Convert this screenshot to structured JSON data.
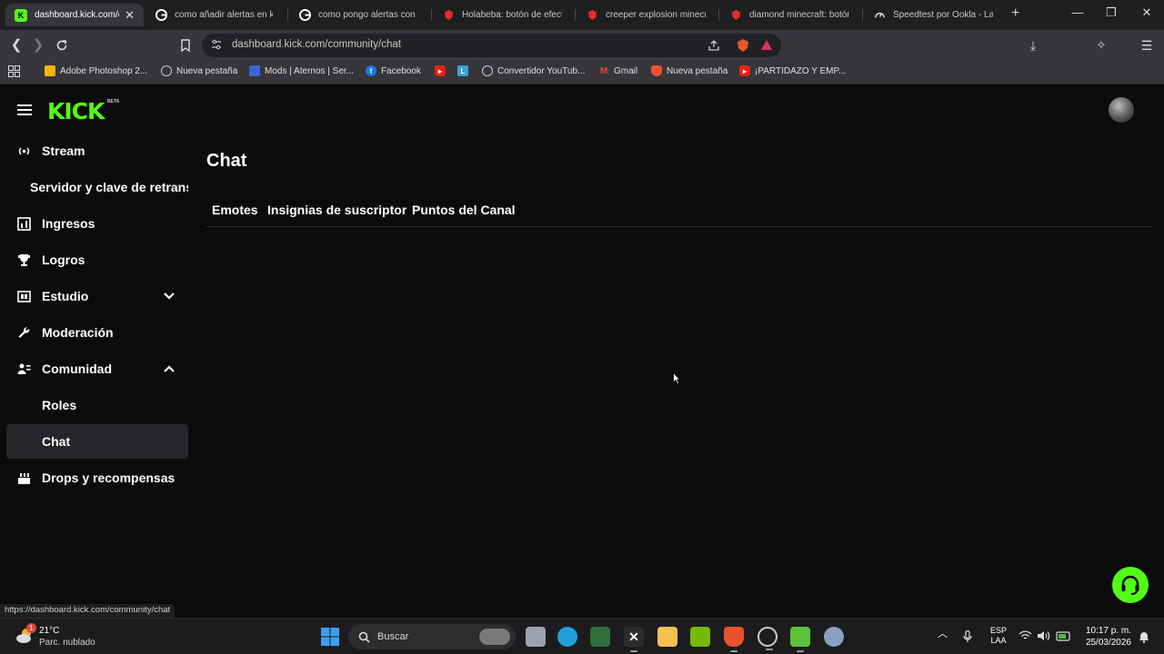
{
  "browser": {
    "tabs": [
      {
        "title": "dashboard.kick.com/c",
        "favicon": "kick-icon",
        "active": true
      },
      {
        "title": "como añadir alertas en kick",
        "favicon": "google-icon"
      },
      {
        "title": "como pongo alertas con p",
        "favicon": "google-icon"
      },
      {
        "title": "Holabeba: botón de efecto",
        "favicon": "brave-icon"
      },
      {
        "title": "creeper explosion minecra",
        "favicon": "brave-icon"
      },
      {
        "title": "diamond minecraft: botón",
        "favicon": "brave-icon"
      },
      {
        "title": "Speedtest por Ookla - La p",
        "favicon": "speedtest-icon"
      }
    ],
    "new_tab_label": "+",
    "url": "dashboard.kick.com/community/chat",
    "bookmarks": [
      {
        "label": "Adobe Photoshop 2...",
        "icon": "photoshop-icon"
      },
      {
        "label": "Nueva pestaña",
        "icon": "globe-icon"
      },
      {
        "label": "Mods | Aternos | Ser...",
        "icon": "aternos-icon"
      },
      {
        "label": "Facebook",
        "icon": "facebook-icon"
      },
      {
        "label": "",
        "icon": "youtube-icon"
      },
      {
        "label": "",
        "icon": "l-icon"
      },
      {
        "label": "Convertidor YouTub...",
        "icon": "globe-icon"
      },
      {
        "label": "Gmail",
        "icon": "gmail-icon"
      },
      {
        "label": "Nueva pestaña",
        "icon": "brave-icon"
      },
      {
        "label": "¡PARTIDAZO Y EMP...",
        "icon": "youtube-icon"
      }
    ],
    "status_url": "https://dashboard.kick.com/community/chat"
  },
  "app": {
    "brand": "KICK",
    "brand_badge": "BETA"
  },
  "sidebar": {
    "items": [
      {
        "label": "Stream",
        "icon": "broadcast-icon"
      },
      {
        "label": "Servidor y clave de retransmisión",
        "icon": ""
      },
      {
        "label": "Ingresos",
        "icon": "chart-icon"
      },
      {
        "label": "Logros",
        "icon": "trophy-icon"
      },
      {
        "label": "Estudio",
        "icon": "studio-icon",
        "expanded": false
      },
      {
        "label": "Moderación",
        "icon": "wrench-icon"
      },
      {
        "label": "Comunidad",
        "icon": "community-icon",
        "expanded": true
      },
      {
        "label": "Roles",
        "icon": ""
      },
      {
        "label": "Chat",
        "icon": "",
        "selected": true
      },
      {
        "label": "Drops y recompensas",
        "icon": "drops-icon"
      }
    ]
  },
  "main": {
    "title": "Chat",
    "tabs": [
      "Emotes",
      "Insignias de suscriptor",
      "Puntos del Canal"
    ]
  },
  "taskbar": {
    "weather_temp": "21°C",
    "weather_desc": "Parc. nublado",
    "weather_badge": "1",
    "search_label": "Buscar",
    "language": "ESP",
    "layout": "LAA",
    "time": "10:17 p. m.",
    "date": "25/03/2026"
  },
  "colors": {
    "kick_green": "#53fc18",
    "page_bg": "#0b0b0c",
    "selected_bg": "#26262a"
  }
}
